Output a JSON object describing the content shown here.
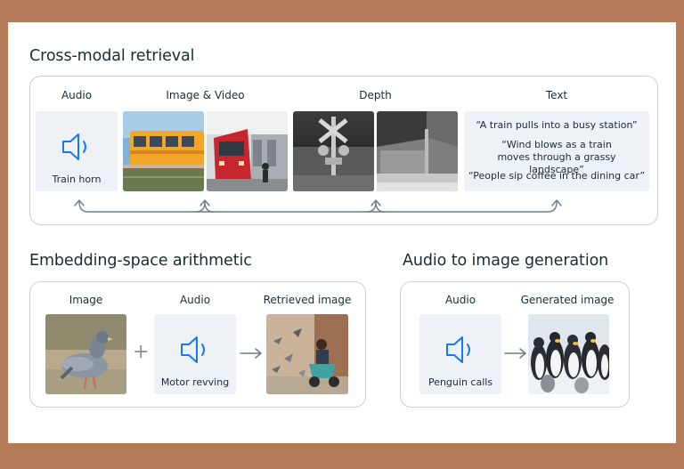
{
  "retrieval": {
    "title": "Cross-modal retrieval",
    "columns": {
      "audio": "Audio",
      "image_video": "Image & Video",
      "depth": "Depth",
      "text": "Text"
    },
    "audio_caption": "Train horn",
    "quotes": [
      "“A train pulls into a busy station”",
      "“Wind blows as a train moves through a grassy landscape”",
      "“People sip coffee in the dining car”"
    ]
  },
  "arithmetic": {
    "title": "Embedding-space arithmetic",
    "image_label": "Image",
    "audio_label": "Audio",
    "retrieved_label": "Retrieved image",
    "audio_caption": "Motor revving",
    "plus": "+"
  },
  "generation": {
    "title": "Audio to image generation",
    "audio_label": "Audio",
    "generated_label": "Generated image",
    "audio_caption": "Penguin calls"
  },
  "colors": {
    "page_background": "#b57a58",
    "speaker_blue": "#1877f2",
    "tile_background": "#eef1f5",
    "connector": "#6b7d8c"
  },
  "icons": {
    "speaker": "speaker-icon",
    "arrow": "arrow-right-icon"
  }
}
